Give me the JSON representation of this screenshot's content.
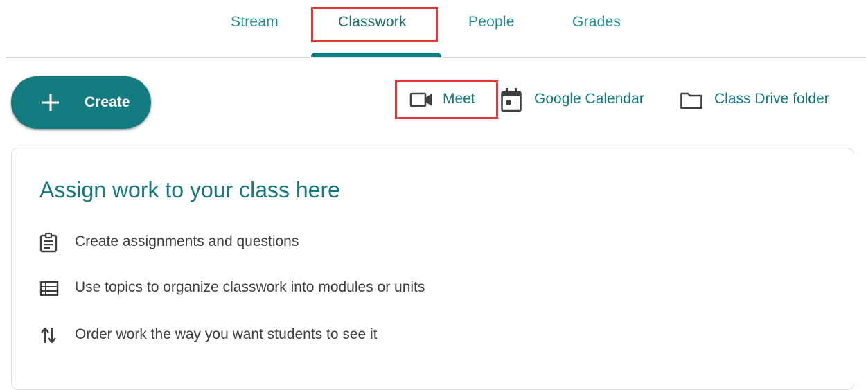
{
  "tabs": [
    {
      "label": "Stream"
    },
    {
      "label": "Classwork",
      "active": true
    },
    {
      "label": "People"
    },
    {
      "label": "Grades"
    }
  ],
  "toolbar": {
    "create_label": "Create",
    "meet_label": "Meet",
    "calendar_label": "Google Calendar",
    "drive_label": "Class Drive folder"
  },
  "card": {
    "title": "Assign work to your class here",
    "items": [
      {
        "icon": "assignment-icon",
        "label": "Create assignments and questions"
      },
      {
        "icon": "topic-list-icon",
        "label": "Use topics to organize classwork into modules or units"
      },
      {
        "icon": "reorder-icon",
        "label": "Order work the way you want students to see it"
      }
    ]
  },
  "colors": {
    "accent": "#137a7f",
    "tab_text": "#1e8e97",
    "highlight": "#e53935",
    "body_text": "#3c4043",
    "divider": "#dadce0"
  }
}
